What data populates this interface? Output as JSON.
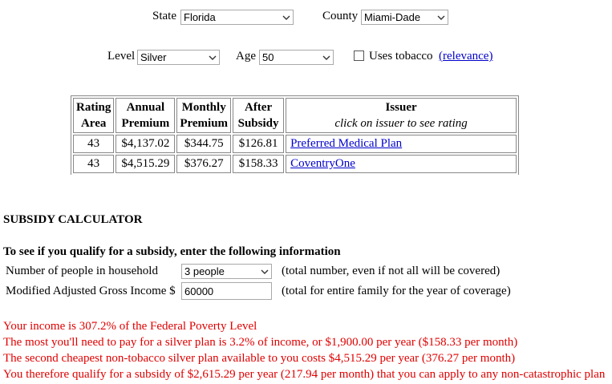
{
  "filters": {
    "state_label": "State",
    "state_value": "Florida",
    "county_label": "County",
    "county_value": "Miami-Dade",
    "level_label": "Level",
    "level_value": "Silver",
    "age_label": "Age",
    "age_value": "50",
    "tobacco_label": "Uses tobacco",
    "relevance_link": "(relevance)"
  },
  "table": {
    "headers": {
      "rating_area": [
        "Rating",
        "Area"
      ],
      "annual_premium": [
        "Annual",
        "Premium"
      ],
      "monthly_premium": [
        "Monthly",
        "Premium"
      ],
      "after_subsidy": [
        "After",
        "Subsidy"
      ],
      "issuer": "Issuer",
      "issuer_note": "click on issuer to see rating"
    },
    "rows": [
      {
        "rating_area": "43",
        "annual": "$4,137.02",
        "monthly": "$344.75",
        "after": "$126.81",
        "issuer": "Preferred Medical Plan"
      },
      {
        "rating_area": "43",
        "annual": "$4,515.29",
        "monthly": "$376.27",
        "after": "$158.33",
        "issuer": "CoventryOne"
      }
    ]
  },
  "calculator": {
    "title": "SUBSIDY CALCULATOR",
    "intro": "To see if you qualify for a subsidy, enter the following information",
    "household_label": "Number of people in household",
    "household_value": "3 people",
    "household_note": "(total number, even if not all will be covered)",
    "income_label": "Modified Adjusted Gross Income $",
    "income_value": "60000",
    "income_note": "(total for entire family for the year of coverage)"
  },
  "results": {
    "line1": "Your income is 307.2% of the Federal Poverty Level",
    "line2": "The most you'll need to pay for a silver plan is 3.2% of income, or $1,900.00 per year ($158.33 per month)",
    "line3": "The second cheapest non-tobacco silver plan available to you costs $4,515.29 per year (376.27 per month)",
    "line4": "You therefore qualify for a subsidy of $2,615.29 per year (217.94 per month) that you can apply to any non-catastrophic plan"
  },
  "colors": {
    "link": "#0000cc",
    "result_text": "#e00000"
  }
}
